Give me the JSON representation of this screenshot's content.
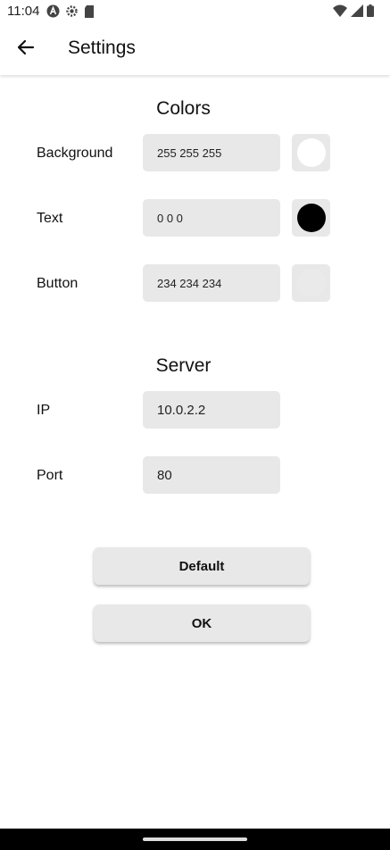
{
  "status_bar": {
    "time": "11:04",
    "left_icons": [
      "android-a-icon",
      "settings-gear-icon",
      "sd-card-icon"
    ],
    "right_icons": [
      "wifi-icon",
      "cell-signal-icon",
      "battery-icon"
    ]
  },
  "app_bar": {
    "title": "Settings",
    "back_icon": "arrow-back-icon"
  },
  "colors_section": {
    "title": "Colors",
    "rows": [
      {
        "label": "Background",
        "value": "255 255 255",
        "swatch_color": "#ffffff"
      },
      {
        "label": "Text",
        "value": "0 0 0",
        "swatch_color": "#000000"
      },
      {
        "label": "Button",
        "value": "234 234 234",
        "swatch_color": "#eaeaea"
      }
    ]
  },
  "server_section": {
    "title": "Server",
    "ip_label": "IP",
    "ip_value": "10.0.2.2",
    "port_label": "Port",
    "port_value": "80"
  },
  "buttons": {
    "default_label": "Default",
    "ok_label": "OK"
  }
}
